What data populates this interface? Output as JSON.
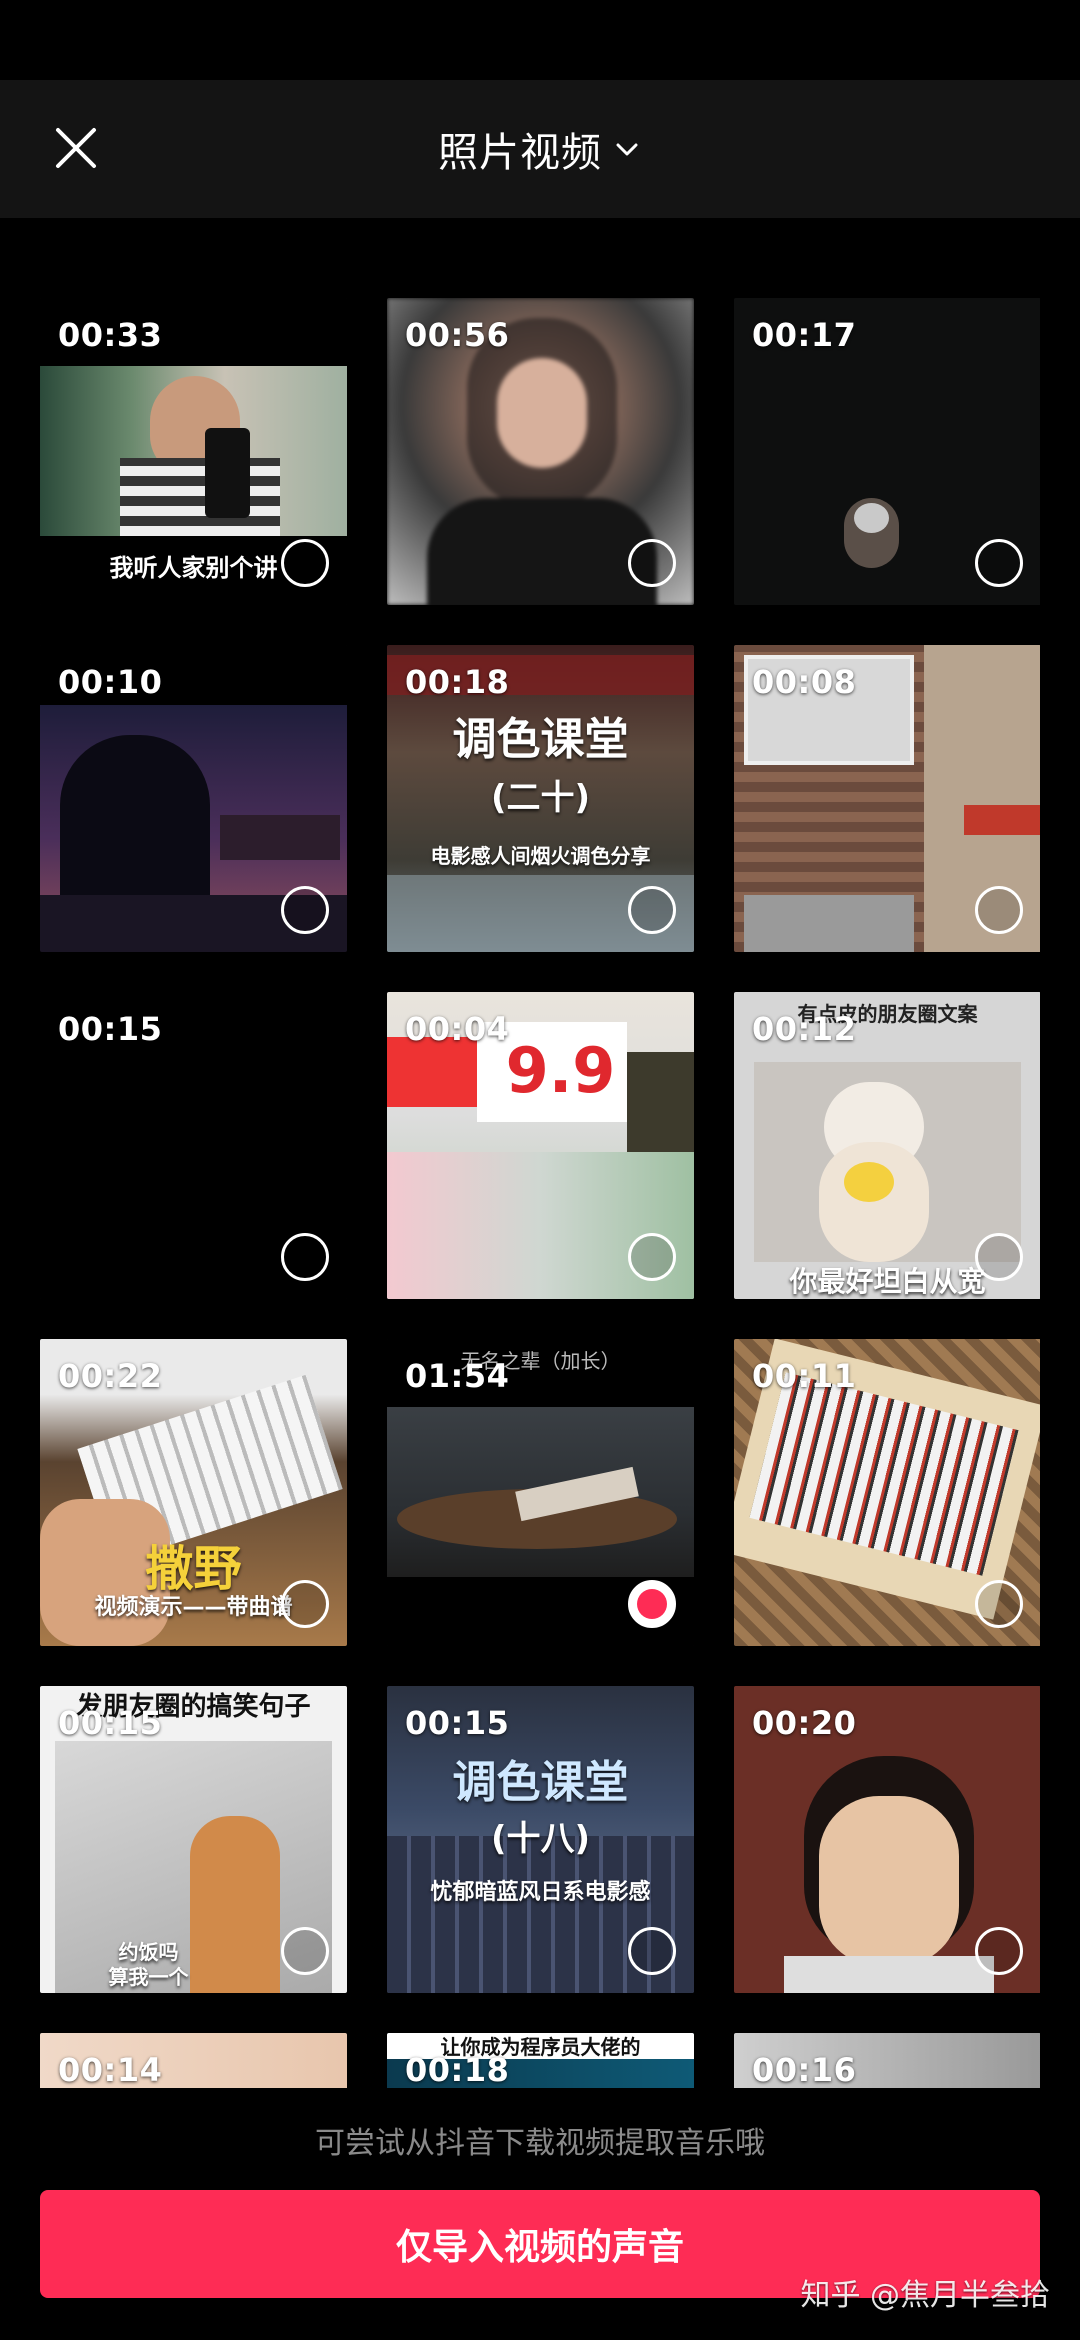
{
  "header": {
    "title": "照片视频",
    "close_icon": "close-icon",
    "dropdown_icon": "chevron-down-icon"
  },
  "grid": {
    "items": [
      {
        "duration": "00:33",
        "caption": "我听人家别个讲",
        "selected": false
      },
      {
        "duration": "00:56",
        "caption": "",
        "selected": false
      },
      {
        "duration": "00:17",
        "caption": "",
        "selected": false
      },
      {
        "duration": "00:10",
        "caption": "",
        "selected": false
      },
      {
        "duration": "00:18",
        "caption": "调色课堂",
        "caption2": "(二十)",
        "caption3": "电影感人间烟火调色分享",
        "selected": false
      },
      {
        "duration": "00:08",
        "caption": "",
        "selected": false
      },
      {
        "duration": "00:15",
        "caption": "",
        "selected": false
      },
      {
        "duration": "00:04",
        "caption": "9.9",
        "selected": false
      },
      {
        "duration": "00:12",
        "caption": "有点皮的朋友圈文案",
        "caption2": "你最好坦白从宽",
        "selected": false
      },
      {
        "duration": "00:22",
        "caption": "撒野",
        "caption2": "视频演示——带曲谱",
        "selected": false
      },
      {
        "duration": "01:54",
        "caption": "无名之辈（加长）",
        "selected": true
      },
      {
        "duration": "00:11",
        "caption": "",
        "selected": false
      },
      {
        "duration": "00:15",
        "caption": "发朋友圈的搞笑句子",
        "caption2": "约饭吗",
        "caption3": "算我一个",
        "selected": false
      },
      {
        "duration": "00:15",
        "caption": "调色课堂",
        "caption2": "(十八)",
        "caption3": "忧郁暗蓝风日系电影感",
        "selected": false
      },
      {
        "duration": "00:20",
        "caption": "",
        "selected": false
      },
      {
        "duration": "00:14",
        "caption": "",
        "selected": false
      },
      {
        "duration": "00:18",
        "caption": "让你成为程序员大佬的",
        "selected": false
      },
      {
        "duration": "00:16",
        "caption": "",
        "selected": false
      }
    ]
  },
  "hint": "可尝试从抖音下载视频提取音乐哦",
  "import_button": "仅导入视频的声音",
  "watermark": "知乎 @焦月半叁拾",
  "colors": {
    "accent": "#fe2c55",
    "header_bg": "#141414",
    "background": "#000000"
  }
}
